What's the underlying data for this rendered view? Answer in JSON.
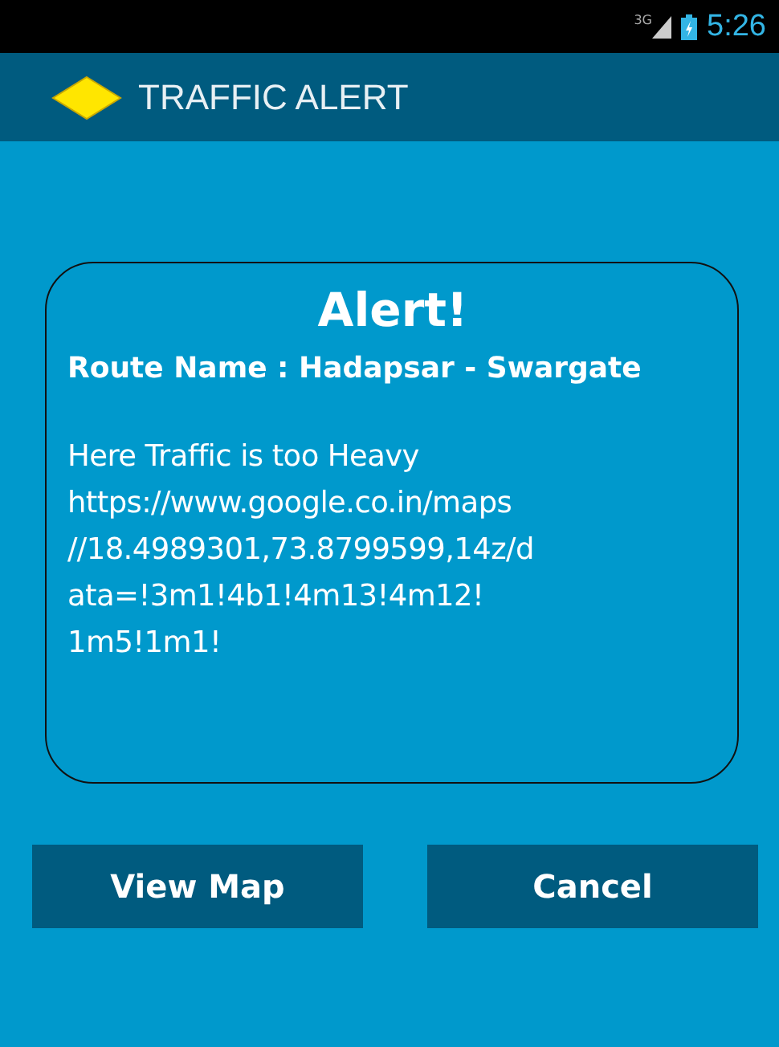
{
  "status_bar": {
    "network": "3G",
    "time": "5:26"
  },
  "action_bar": {
    "title": "TRAFFIC ALERT"
  },
  "alert": {
    "title": "Alert!",
    "route": "Route Name : Hadapsar - Swargate",
    "message_lines": [
      "Here Traffic is too Heavy",
      "https://www.google.co.in/maps",
      "//18.4989301,73.8799599,14z/d",
      "ata=!3m1!4b1!4m13!4m12!",
      "1m5!1m1!"
    ]
  },
  "buttons": [
    "View Map",
    "Cancel"
  ]
}
